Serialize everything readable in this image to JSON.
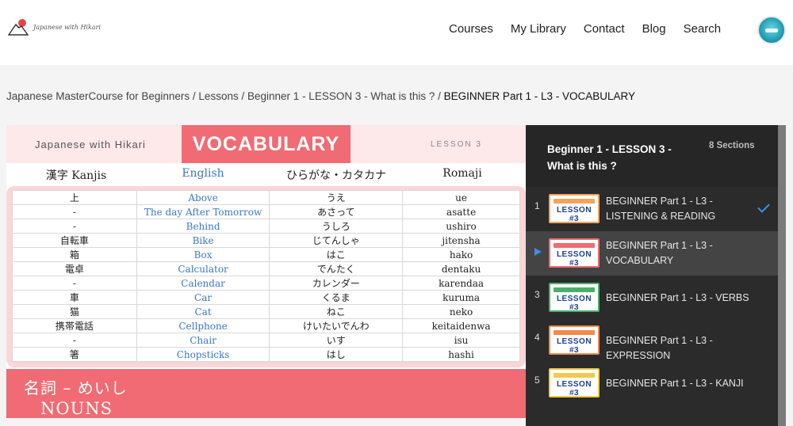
{
  "site": {
    "logo_text": "Japanese with Hikari",
    "nav": [
      "Courses",
      "My Library",
      "Contact",
      "Blog",
      "Search"
    ]
  },
  "breadcrumb": {
    "items": [
      "Japanese MasterCourse for Beginners",
      "Lessons",
      "Beginner 1 - LESSON 3 - What is this ?"
    ],
    "separator": "/",
    "current": "BEGINNER Part 1 - L3 - VOCABULARY"
  },
  "lesson_image": {
    "brand": "Japanese with Hikari",
    "title": "VOCABULARY",
    "lesson": "LESSON 3",
    "columns": [
      "漢字 Kanjis",
      "English",
      "ひらがな・カタカナ",
      "Romaji"
    ],
    "rows": [
      [
        "上",
        "Above",
        "うえ",
        "ue"
      ],
      [
        "-",
        "The day After Tomorrow",
        "あさって",
        "asatte"
      ],
      [
        "-",
        "Behind",
        "うしろ",
        "ushiro"
      ],
      [
        "自転車",
        "Bike",
        "じてんしゃ",
        "jitensha"
      ],
      [
        "箱",
        "Box",
        "はこ",
        "hako"
      ],
      [
        "電卓",
        "Calculator",
        "でんたく",
        "dentaku"
      ],
      [
        "-",
        "Calendar",
        "カレンダー",
        "karendaa"
      ],
      [
        "車",
        "Car",
        "くるま",
        "kuruma"
      ],
      [
        "猫",
        "Cat",
        "ねこ",
        "neko"
      ],
      [
        "携帯電話",
        "Cellphone",
        "けいたいでんわ",
        "keitaidenwa"
      ],
      [
        "-",
        "Chair",
        "いす",
        "isu"
      ],
      [
        "箸",
        "Chopsticks",
        "はし",
        "hashi"
      ]
    ],
    "footer_jp": "名詞 – めいし",
    "footer_en": "NOUNS"
  },
  "sidebar": {
    "title": "Beginner 1 - LESSON 3 - What is this ?",
    "sections": "8 Sections",
    "items": [
      {
        "num": "1",
        "label": "BEGINNER Part 1 - L3 - LISTENING & READING",
        "thumb_text": "LESSON #3",
        "band_color": "#f2a35e",
        "completed": true
      },
      {
        "num": "",
        "label": "BEGINNER Part 1 - L3 - VOCABULARY",
        "thumb_text": "LESSON #3",
        "band_color": "#f06b73",
        "active": true
      },
      {
        "num": "3",
        "label": "BEGINNER Part 1 - L3 - VERBS",
        "thumb_text": "LESSON #3",
        "band_color": "#4cae6a"
      },
      {
        "num": "4",
        "label": "BEGINNER Part 1 - L3 - EXPRESSION",
        "thumb_text": "LESSON #3",
        "band_color": "#f28a4d"
      },
      {
        "num": "5",
        "label": "BEGINNER Part 1 - L3 - KANJI",
        "thumb_text": "LESSON #3",
        "band_color": "#f2c94c"
      }
    ]
  },
  "colors": {
    "accent_red": "#f06b73",
    "english_blue": "#3a78c8",
    "sidebar_bg": "#2b2b2b",
    "check_blue": "#3c8ee8"
  }
}
